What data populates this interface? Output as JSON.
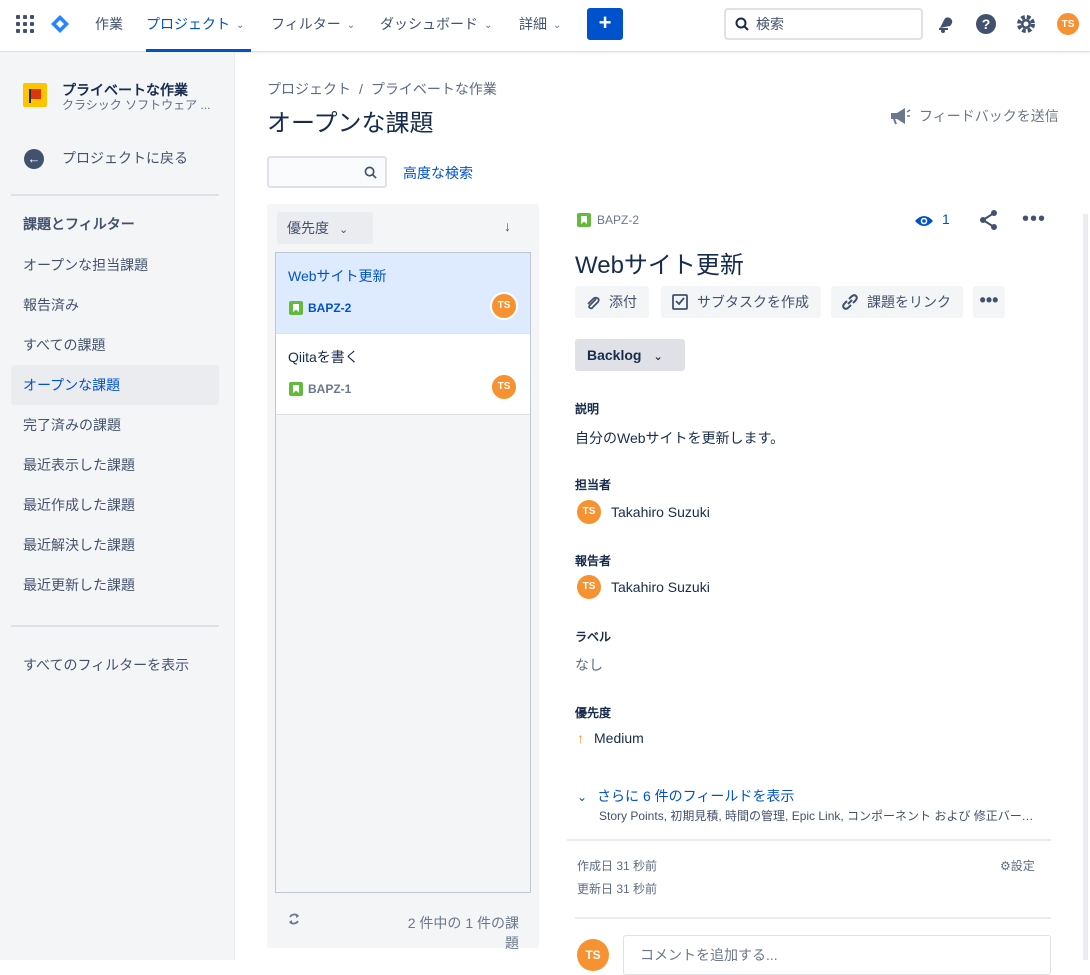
{
  "topnav": {
    "items": [
      {
        "label": "作業"
      },
      {
        "label": "プロジェクト"
      },
      {
        "label": "フィルター"
      },
      {
        "label": "ダッシュボード"
      },
      {
        "label": "詳細"
      }
    ],
    "create_label": "+",
    "search_placeholder": "検索",
    "user_initials": "TS"
  },
  "sidebar": {
    "project_name": "プライベートな作業",
    "project_type": "クラシック ソフトウェア ...",
    "back_label": "プロジェクトに戻る",
    "section_title": "課題とフィルター",
    "items": [
      {
        "label": "オープンな担当課題"
      },
      {
        "label": "報告済み"
      },
      {
        "label": "すべての課題"
      },
      {
        "label": "オープンな課題"
      },
      {
        "label": "完了済みの課題"
      },
      {
        "label": "最近表示した課題"
      },
      {
        "label": "最近作成した課題"
      },
      {
        "label": "最近解決した課題"
      },
      {
        "label": "最近更新した課題"
      }
    ],
    "all_filters_label": "すべてのフィルターを表示"
  },
  "header": {
    "breadcrumb": [
      "プロジェクト",
      "/",
      "プライベートな作業"
    ],
    "title": "オープンな課題",
    "feedback_label": "フィードバックを送信"
  },
  "search": {
    "placeholder": "",
    "advanced_label": "高度な検索"
  },
  "issue_list": {
    "sort_label": "優先度",
    "sort_direction": "↓",
    "issues": [
      {
        "summary": "Webサイト更新",
        "key": "BAPZ-2",
        "assignee": "TS"
      },
      {
        "summary": "Qiitaを書く",
        "key": "BAPZ-1",
        "assignee": "TS"
      }
    ],
    "count_label": "2 件中の 1 件の課題"
  },
  "detail": {
    "key": "BAPZ-2",
    "watchers": "1",
    "title": "Webサイト更新",
    "actions": {
      "attach": "添付",
      "subtask": "サブタスクを作成",
      "link": "課題をリンク"
    },
    "status": "Backlog",
    "fields": {
      "description_label": "説明",
      "description": "自分のWebサイトを更新します。",
      "assignee_label": "担当者",
      "assignee": "Takahiro Suzuki",
      "assignee_initials": "TS",
      "reporter_label": "報告者",
      "reporter": "Takahiro Suzuki",
      "reporter_initials": "TS",
      "labels_label": "ラベル",
      "labels": "なし",
      "priority_label": "優先度",
      "priority": "Medium"
    },
    "more_fields": "さらに 6 件のフィールドを表示",
    "more_fields_sub": "Story Points, 初期見積, 時間の管理, Epic Link, コンポーネント および 修正バージョン",
    "created": "作成日 31 秒前",
    "updated": "更新日 31 秒前",
    "settings_label": "設定",
    "comment_initials": "TS",
    "comment_placeholder": "コメントを追加する..."
  },
  "colors": {
    "brand": "#0052cc",
    "avatar": "#f79232",
    "story": "#63ba3c",
    "priority_medium": "#ff991f"
  }
}
